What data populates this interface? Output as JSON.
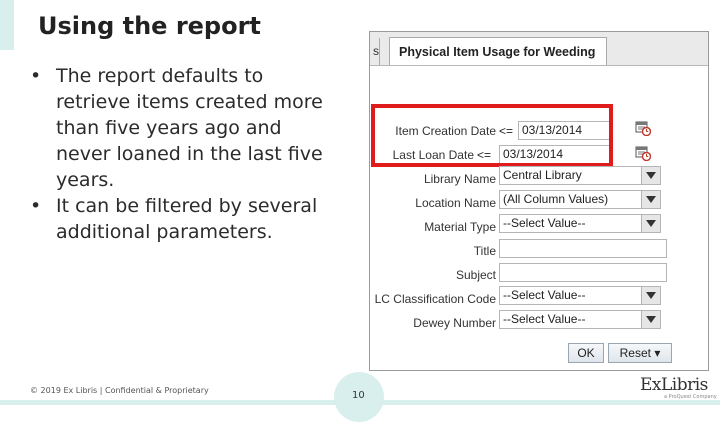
{
  "slide": {
    "title": "Using the report",
    "bullets": [
      "The report defaults to retrieve items created more than five years ago and never loaned in the last five years.",
      "It can be filtered by several additional parameters."
    ],
    "bullet_glyph": "•",
    "footer": "© 2019 Ex Libris | Confidential & Proprietary",
    "page_number": "10",
    "logo_text": "ExLibris",
    "logo_tagline": "a ProQuest Company",
    "accent_color": "#d9efee"
  },
  "report": {
    "tab_stub_label": "s",
    "tab_title": "Physical Item Usage for Weeding",
    "rows": [
      {
        "label": "Item Creation Date",
        "operator": "<=",
        "value": "03/13/2014",
        "type": "date"
      },
      {
        "label": "Last Loan Date",
        "operator": "<=",
        "value": "03/13/2014",
        "type": "date"
      },
      {
        "label": "Library Name",
        "value": "Central Library",
        "type": "select"
      },
      {
        "label": "Location Name",
        "value": "(All Column Values)",
        "type": "select"
      },
      {
        "label": "Material Type",
        "value": "--Select Value--",
        "type": "select"
      },
      {
        "label": "Title",
        "value": "",
        "type": "text"
      },
      {
        "label": "Subject",
        "value": "",
        "type": "text"
      },
      {
        "label": "LC Classification Code",
        "value": "--Select Value--",
        "type": "select"
      },
      {
        "label": "Dewey Number",
        "value": "--Select Value--",
        "type": "select"
      }
    ],
    "ok_label": "OK",
    "reset_label": "Reset ▾",
    "highlight_color": "#e01b1b"
  }
}
